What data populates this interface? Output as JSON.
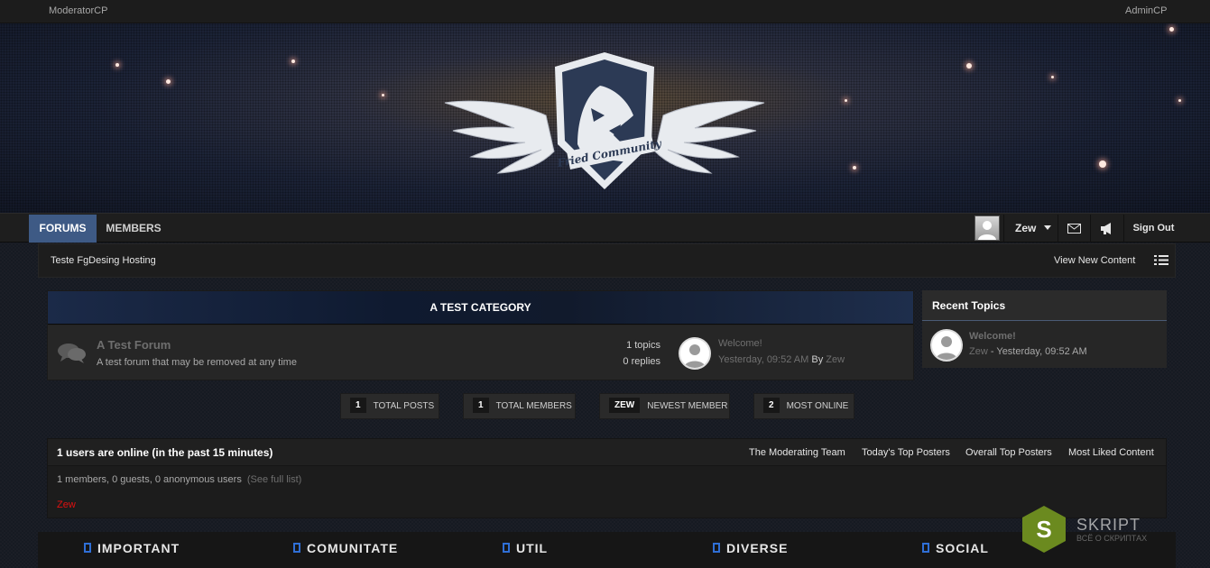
{
  "topbar": {
    "left_link": "ModeratorCP",
    "right_link": "AdminCP"
  },
  "logo_text": "Fried Community",
  "nav": {
    "tabs": [
      {
        "label": "FORUMS",
        "active": true
      },
      {
        "label": "MEMBERS",
        "active": false
      }
    ],
    "username": "Zew",
    "signout": "Sign Out",
    "icons": [
      "mail-icon",
      "megaphone-icon"
    ]
  },
  "breadcrumb": {
    "label": "Teste FgDesing Hosting",
    "view_new": "View New Content"
  },
  "category": {
    "title": "A TEST CATEGORY",
    "forum": {
      "title": "A Test Forum",
      "description": "A test forum that may be removed at any time",
      "topics": "1 topics",
      "replies": "0 replies",
      "last_post_title": "Welcome!",
      "last_post_time": "Yesterday, 09:52 AM",
      "last_post_by": "By",
      "last_post_author": "Zew"
    }
  },
  "recent_topics": {
    "title": "Recent Topics",
    "items": [
      {
        "title": "Welcome!",
        "author": "Zew",
        "time": "- Yesterday, 09:52 AM"
      }
    ]
  },
  "stats": [
    {
      "value": "1",
      "label": "TOTAL POSTS"
    },
    {
      "value": "1",
      "label": "TOTAL MEMBERS"
    },
    {
      "value": "ZEW",
      "label": "NEWEST MEMBER"
    },
    {
      "value": "2",
      "label": "MOST ONLINE"
    }
  ],
  "online": {
    "title": "1 users are online (in the past 15 minutes)",
    "links": [
      "The Moderating Team",
      "Today's Top Posters",
      "Overall Top Posters",
      "Most Liked Content"
    ],
    "summary": "1 members, 0 guests, 0 anonymous users",
    "full_list": "(See full list)",
    "users": [
      "Zew"
    ]
  },
  "footer": {
    "items": [
      "IMPORTANT",
      "COMUNITATE",
      "UTIL",
      "DIVERSE",
      "SOCIAL"
    ]
  },
  "watermark": {
    "text": "SKRIPT",
    "subtext": "ВСЁ О СКРИПТАХ",
    "letter": "S"
  },
  "colors": {
    "accent": "#3e5a85",
    "online_user": "#e01010",
    "footer_square": "#2f6fd6"
  }
}
